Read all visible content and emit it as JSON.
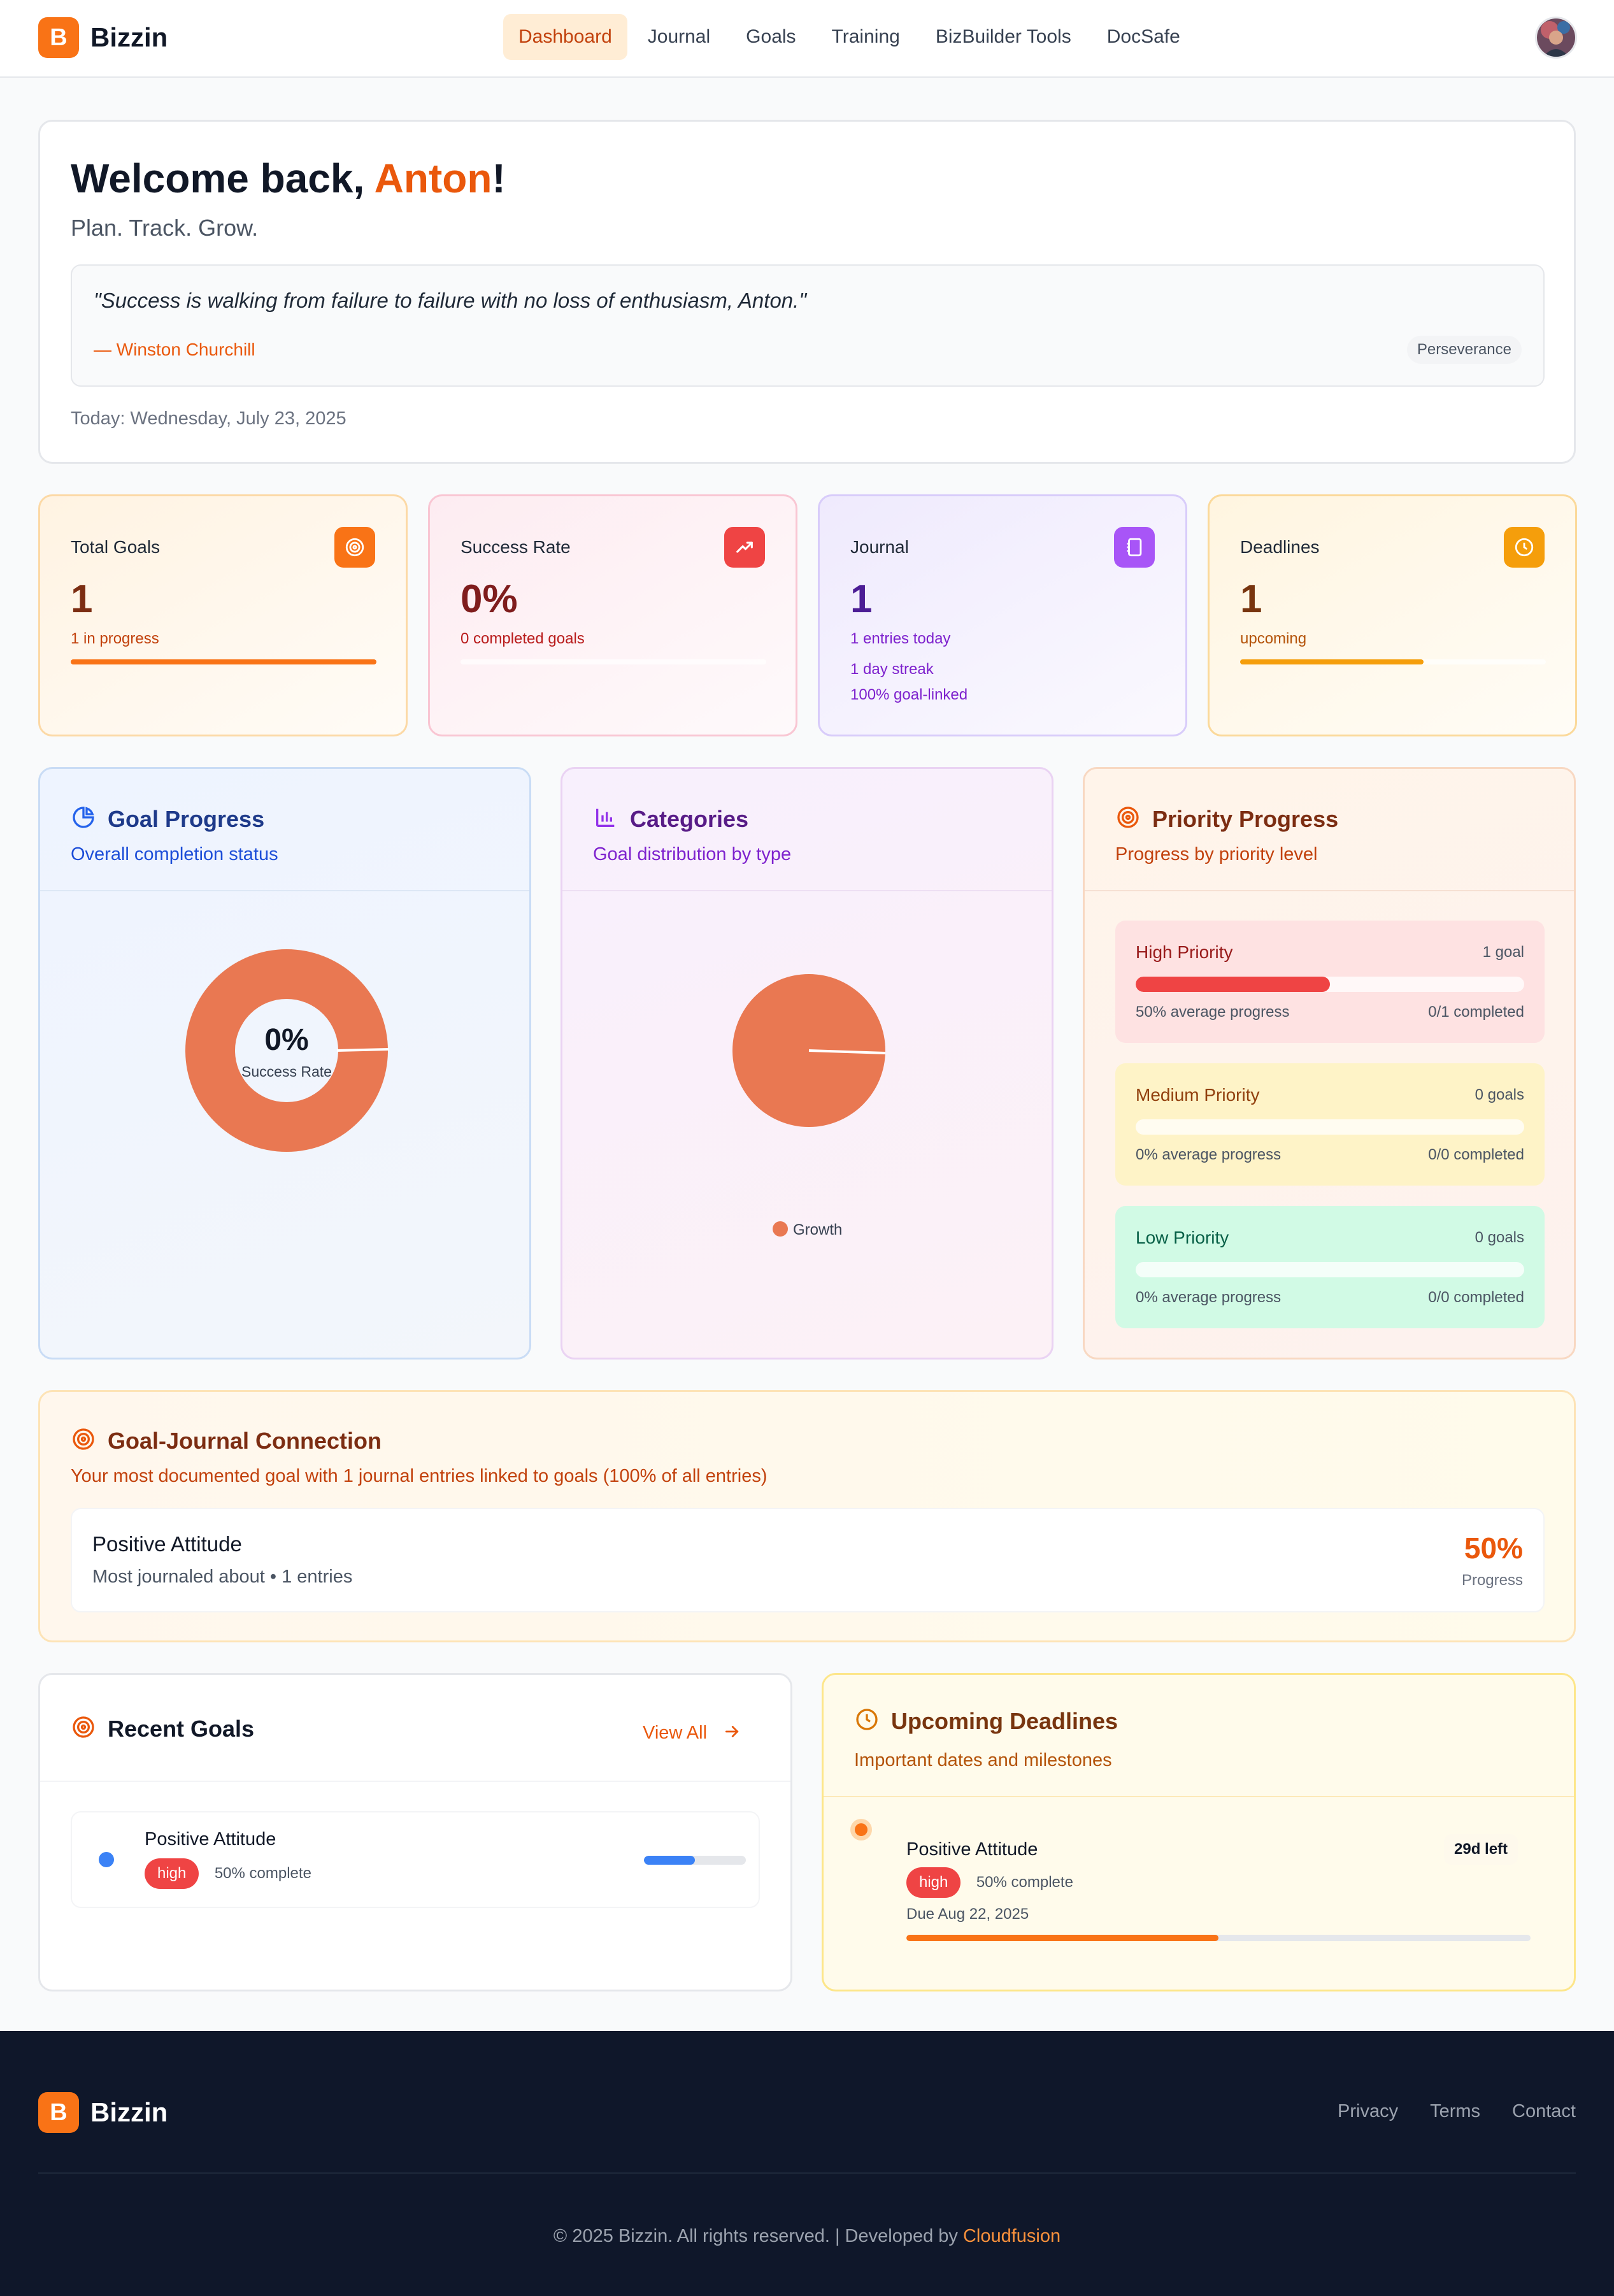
{
  "app": {
    "logo_letter": "B",
    "name": "Bizzin"
  },
  "nav": {
    "items": [
      "Dashboard",
      "Journal",
      "Goals",
      "Training",
      "BizBuilder Tools",
      "DocSafe"
    ],
    "active": "Dashboard"
  },
  "welcome": {
    "greeting": "Welcome back, ",
    "name": "Anton",
    "exclaim": "!",
    "tagline": "Plan. Track. Grow.",
    "quote": "\"Success is walking from failure to failure with no loss of enthusiasm, Anton.\"",
    "author": "— Winston Churchill",
    "quote_tag": "Perseverance",
    "today": "Today: Wednesday, July 23, 2025"
  },
  "stats": [
    {
      "label": "Total Goals",
      "value": "1",
      "sub": "1 in progress",
      "icon": "target-icon",
      "progress": 1.0,
      "colors": {
        "bg": "#fff3e2",
        "border": "#fcd9a6",
        "icon": "#f97316",
        "value": "#7c2d12",
        "sub": "#c2410c",
        "fill": "#f97316"
      }
    },
    {
      "label": "Success Rate",
      "value": "0%",
      "sub": "0 completed goals",
      "icon": "trending-up-icon",
      "progress": 0.0,
      "colors": {
        "bg": "#fdecf1",
        "border": "#f9c6d3",
        "icon": "#ef4444",
        "value": "#7f1d1d",
        "sub": "#b91c1c",
        "fill": "#ef4444"
      }
    },
    {
      "label": "Journal",
      "value": "1",
      "sub": "1 entries today",
      "sub2": "1 day streak",
      "sub3": "100% goal-linked",
      "icon": "notebook-icon",
      "colors": {
        "bg": "#efeafd",
        "border": "#d8ccfa",
        "icon": "#a855f7",
        "value": "#4c1d95",
        "sub": "#7e22ce"
      }
    },
    {
      "label": "Deadlines",
      "value": "1",
      "sub": "upcoming",
      "icon": "clock-icon",
      "progress": 0.6,
      "colors": {
        "bg": "#fff5e0",
        "border": "#fbd99a",
        "icon": "#f59e0b",
        "value": "#78350f",
        "sub": "#b45309",
        "fill": "#f59e0b"
      }
    }
  ],
  "goal_progress": {
    "title": "Goal Progress",
    "subtitle": "Overall completion status",
    "center_value": "0%",
    "center_label": "Success Rate",
    "color": "#e97852"
  },
  "categories": {
    "title": "Categories",
    "subtitle": "Goal distribution by type",
    "legend": [
      "Growth"
    ],
    "color": "#e97852"
  },
  "priority": {
    "title": "Priority Progress",
    "subtitle": "Progress by priority level",
    "levels": [
      {
        "name": "High Priority",
        "count": "1 goal",
        "progress": 0.5,
        "avg": "50% average progress",
        "done": "0/1 completed",
        "bg": "#fee2e2",
        "name_color": "#991b1b",
        "fill": "#ef4444"
      },
      {
        "name": "Medium Priority",
        "count": "0 goals",
        "progress": 0.0,
        "avg": "0% average progress",
        "done": "0/0 completed",
        "bg": "#fef3c7",
        "name_color": "#92400e",
        "fill": "#f59e0b"
      },
      {
        "name": "Low Priority",
        "count": "0 goals",
        "progress": 0.0,
        "avg": "0% average progress",
        "done": "0/0 completed",
        "bg": "#d1fae5",
        "name_color": "#065f46",
        "fill": "#10b981"
      }
    ]
  },
  "connection": {
    "title": "Goal-Journal Connection",
    "subtitle": "Your most documented goal with 1 journal entries linked to goals (100% of all entries)",
    "goal": "Positive Attitude",
    "meta": "Most journaled about • 1 entries",
    "percent": "50%",
    "percent_label": "Progress"
  },
  "recent": {
    "title": "Recent Goals",
    "view_all": "View All",
    "items": [
      {
        "name": "Positive Attitude",
        "priority": "high",
        "complete": "50% complete",
        "progress": 0.5
      }
    ]
  },
  "upcoming": {
    "title": "Upcoming Deadlines",
    "subtitle": "Important dates and milestones",
    "items": [
      {
        "name": "Positive Attitude",
        "priority": "high",
        "complete": "50% complete",
        "due": "Due Aug 22, 2025",
        "left": "29d left",
        "progress": 0.5
      }
    ]
  },
  "footer": {
    "links": [
      "Privacy",
      "Terms",
      "Contact"
    ],
    "copyright": "© 2025 Bizzin. All rights reserved. | Developed by ",
    "developer": "Cloudfusion"
  }
}
